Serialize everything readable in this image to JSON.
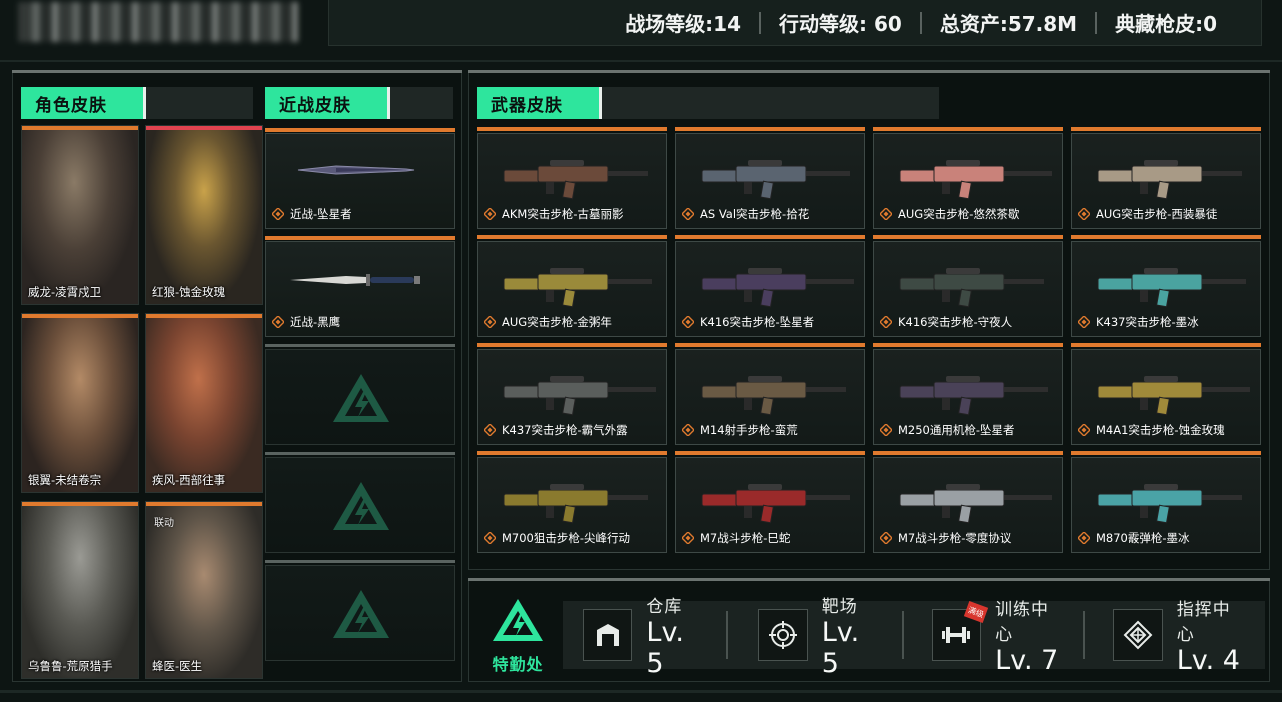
{
  "header": {
    "stats": [
      {
        "label": "战场等级:14"
      },
      {
        "label": "行动等级: 60"
      },
      {
        "label": "总资产:57.8M"
      },
      {
        "label": "典藏枪皮:0"
      }
    ]
  },
  "sections": {
    "character": "角色皮肤",
    "melee": "近战皮肤",
    "weapon": "武器皮肤"
  },
  "characters": [
    {
      "name": "威龙-凌霄戍卫",
      "tag": "",
      "accent": "#e07a2e"
    },
    {
      "name": "红狼-蚀金玫瑰",
      "tag": "",
      "accent": "#e0434f"
    },
    {
      "name": "银翼-未结卷宗",
      "tag": "",
      "accent": "#e07a2e"
    },
    {
      "name": "疾风-西部往事",
      "tag": "",
      "accent": "#e07a2e"
    },
    {
      "name": "乌鲁鲁-荒原猎手",
      "tag": "",
      "accent": "#e07a2e"
    },
    {
      "name": "蜂医-医生",
      "tag": "联动",
      "accent": "#e07a2e"
    }
  ],
  "melee": [
    {
      "name": "近战-坠星者",
      "empty": false
    },
    {
      "name": "近战-黑鹰",
      "empty": false
    },
    {
      "name": "",
      "empty": true
    },
    {
      "name": "",
      "empty": true
    },
    {
      "name": "",
      "empty": true
    }
  ],
  "weapons": [
    {
      "name": "AKM突击步枪-古墓丽影",
      "color": "#6b4a3a"
    },
    {
      "name": "AS Val突击步枪-拾花",
      "color": "#5a6470"
    },
    {
      "name": "AUG突击步枪-悠然茶歇",
      "color": "#c9827a"
    },
    {
      "name": "AUG突击步枪-西装暴徒",
      "color": "#a89a86"
    },
    {
      "name": "AUG突击步枪-金粥年",
      "color": "#9a8a3a"
    },
    {
      "name": "K416突击步枪-坠星者",
      "color": "#4a3e5e"
    },
    {
      "name": "K416突击步枪-守夜人",
      "color": "#3e4a44"
    },
    {
      "name": "K437突击步枪-墨冰",
      "color": "#4aa3a0"
    },
    {
      "name": "K437突击步枪-霸气外露",
      "color": "#5a5e5c"
    },
    {
      "name": "M14射手步枪-蛮荒",
      "color": "#6a5a44"
    },
    {
      "name": "M250通用机枪-坠星者",
      "color": "#4a4258"
    },
    {
      "name": "M4A1突击步枪-蚀金玫瑰",
      "color": "#a08a3a"
    },
    {
      "name": "M700狙击步枪-尖峰行动",
      "color": "#8a7a2e"
    },
    {
      "name": "M7战斗步枪-巳蛇",
      "color": "#9a2a2a"
    },
    {
      "name": "M7战斗步枪-零度协议",
      "color": "#9aa0a4"
    },
    {
      "name": "M870霰弹枪-墨冰",
      "color": "#4aa3a6"
    }
  ],
  "bottom": {
    "agency_label": "特勤处",
    "facilities": [
      {
        "name": "仓库",
        "level": "Lv. 5",
        "icon": "warehouse-icon",
        "badge": ""
      },
      {
        "name": "靶场",
        "level": "Lv. 5",
        "icon": "target-icon",
        "badge": ""
      },
      {
        "name": "训练中心",
        "level": "Lv. 7",
        "icon": "dumbbell-icon",
        "badge": "满级"
      },
      {
        "name": "指挥中心",
        "level": "Lv. 4",
        "icon": "command-icon",
        "badge": ""
      }
    ]
  },
  "colors": {
    "accent_green": "#2ee59d",
    "accent_orange": "#e07a2e",
    "background": "#0d1513"
  }
}
